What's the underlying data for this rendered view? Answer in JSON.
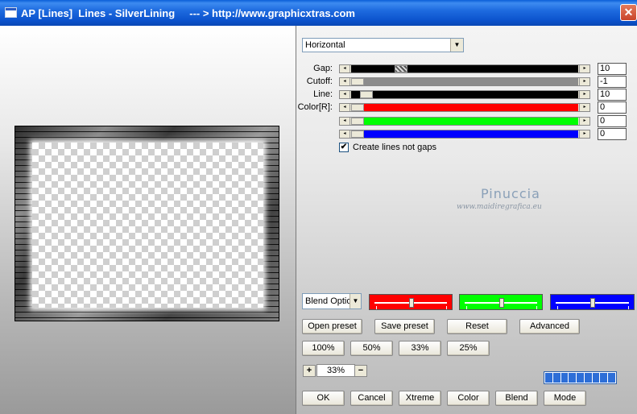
{
  "window": {
    "title": "AP [Lines]  Lines - SilverLining     --- > http://www.graphicxtras.com",
    "close_glyph": "✕"
  },
  "orientation_select": {
    "value": "Horizontal"
  },
  "sliders": [
    {
      "label": "Gap:",
      "value": "10",
      "track_color": "#000000"
    },
    {
      "label": "Cutoff:",
      "value": "-1",
      "track_color": "#8c8c8c"
    },
    {
      "label": "Line:",
      "value": "10",
      "track_color": "#000000"
    },
    {
      "label": "Color[R]:",
      "value": "0",
      "track_color": "#ff0000"
    },
    {
      "label": "",
      "value": "0",
      "track_color": "#00ff00"
    },
    {
      "label": "",
      "value": "0",
      "track_color": "#0000ff"
    }
  ],
  "create_lines_checkbox": {
    "label": "Create lines not gaps",
    "checked": true,
    "check_glyph": "✔"
  },
  "watermark": {
    "name": "Pinuccia",
    "site": "www.maidiregrafica.eu"
  },
  "blend_options_select": {
    "value": "Blend Optio"
  },
  "color_panels": [
    {
      "color": "#ff0000"
    },
    {
      "color": "#00ff00"
    },
    {
      "color": "#0000ff"
    }
  ],
  "preset_buttons": {
    "open_preset": "Open preset",
    "save_preset": "Save preset",
    "reset": "Reset",
    "advanced": "Advanced"
  },
  "zoom_buttons": [
    "100%",
    "50%",
    "33%",
    "25%"
  ],
  "zoom_control": {
    "minus": "−",
    "plus": "+",
    "value": "33%"
  },
  "progress": {
    "segments_filled": 9,
    "segments_total": 9
  },
  "bottom_buttons": {
    "ok": "OK",
    "cancel": "Cancel",
    "xtreme": "Xtreme",
    "color": "Color",
    "blend": "Blend",
    "mode": "Mode"
  }
}
